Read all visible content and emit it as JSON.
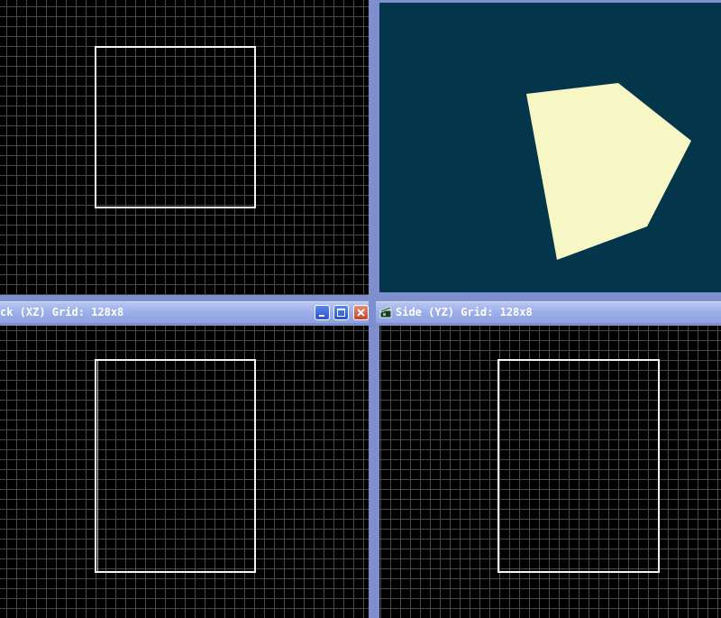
{
  "viewports": {
    "top_left": {
      "name": ""
    },
    "perspective": {
      "shape_color": "#f7f7c6",
      "background": "#03364a"
    },
    "back": {
      "title": "ck (XZ) Grid: 128x8"
    },
    "side": {
      "title": "Side (YZ) Grid: 128x8"
    }
  },
  "window_buttons": [
    "minimize-icon",
    "maximize-icon",
    "close-icon"
  ],
  "colors": {
    "grid_background": "#000000",
    "grid_lines": "#4a4a4a",
    "brush_outline": "#f4f4f4",
    "titlebar": "#8ea2e2",
    "frame": "#7e8fd0"
  }
}
